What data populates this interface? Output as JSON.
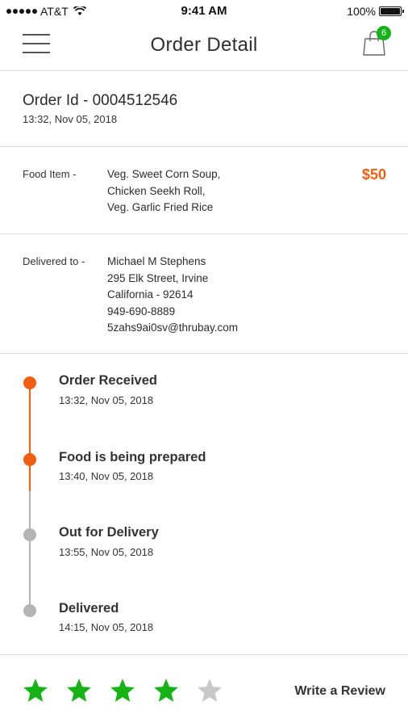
{
  "status_bar": {
    "carrier": "AT&T",
    "time": "9:41 AM",
    "battery": "100%"
  },
  "nav": {
    "title": "Order Detail",
    "cart_count": "6"
  },
  "order": {
    "id_label": "Order Id - 0004512546",
    "datetime": "13:32, Nov 05, 2018"
  },
  "food": {
    "label": "Food Item -",
    "items": [
      "Veg. Sweet Corn Soup,",
      "Chicken Seekh Roll,",
      "Veg. Garlic Fried Rice"
    ],
    "price": "$50"
  },
  "delivery": {
    "label": "Delivered to -",
    "lines": [
      "Michael M Stephens",
      "295  Elk Street, Irvine",
      "California - 92614",
      "949-690-8889",
      "5zahs9ai0sv@thrubay.com"
    ]
  },
  "timeline": [
    {
      "title": "Order Received",
      "time": "13:32, Nov 05, 2018",
      "status": "done"
    },
    {
      "title": "Food is being prepared",
      "time": "13:40, Nov 05, 2018",
      "status": "done"
    },
    {
      "title": "Out for Delivery",
      "time": "13:55, Nov 05, 2018",
      "status": "pending"
    },
    {
      "title": "Delivered",
      "time": "14:15, Nov 05, 2018",
      "status": "pending"
    }
  ],
  "rating": {
    "value": 4,
    "max": 5,
    "review_label": "Write a Review"
  },
  "colors": {
    "accent": "#f35d12",
    "star_active": "#16b316",
    "star_inactive": "#c8c8c8",
    "pending": "#b4b4b4"
  }
}
